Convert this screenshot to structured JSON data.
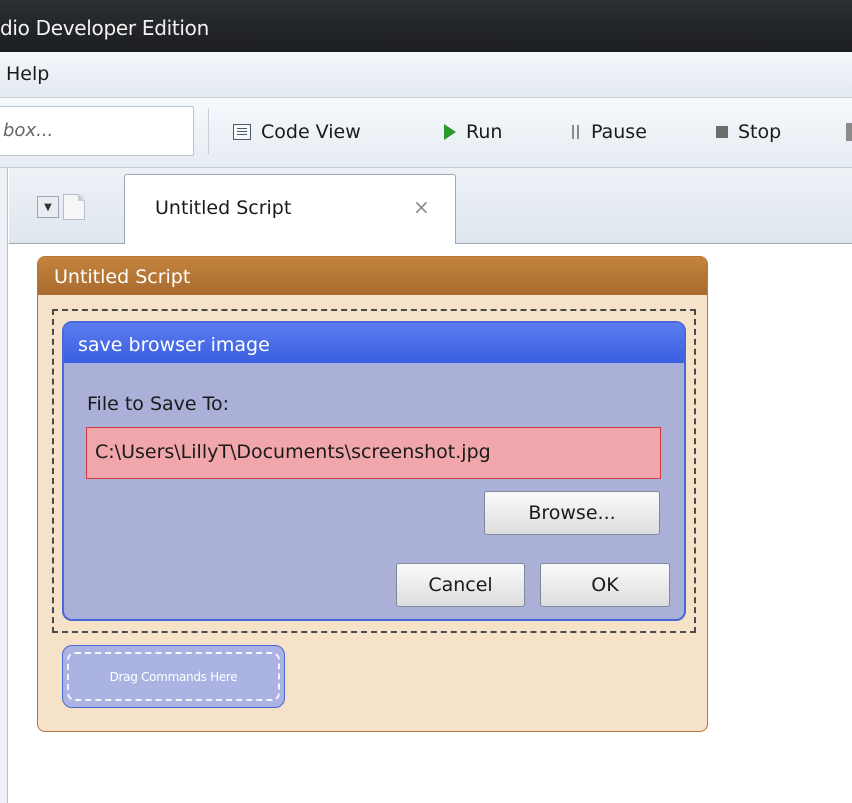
{
  "window": {
    "title": "dio Developer Edition"
  },
  "menubar": {
    "items": [
      {
        "label": "Help"
      }
    ]
  },
  "toolbar": {
    "search_text": "box...",
    "buttons": [
      {
        "label": "Code View",
        "icon": "code-view-icon"
      },
      {
        "label": "Run",
        "icon": "play-icon",
        "color": "#2a9a2a"
      },
      {
        "label": "Pause",
        "icon": "pause-icon"
      },
      {
        "label": "Stop",
        "icon": "stop-icon"
      }
    ]
  },
  "tabs": [
    {
      "label": "Untitled Script",
      "close_glyph": "×",
      "active": true
    }
  ],
  "script": {
    "title": "Untitled Script",
    "color": "#b5773a",
    "command": {
      "title": "save browser image",
      "color": "#4a67d6",
      "field_label": "File to Save To:",
      "file_value": "C:\\Users\\LillyT\\Documents\\screenshot.jpg",
      "browse_label": "Browse...",
      "cancel_label": "Cancel",
      "ok_label": "OK"
    },
    "drop_hint": "Drag Commands Here"
  }
}
